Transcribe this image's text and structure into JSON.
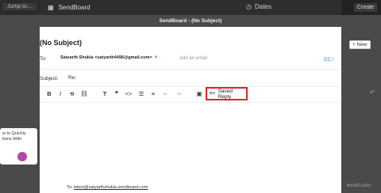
{
  "topbar": {
    "jump_placeholder": "Jump to...",
    "brand": "SendBoard",
    "dates": "Dates",
    "create": "Create"
  },
  "compose": {
    "title": "SendBoard - (No Subject)",
    "heading": "(No Subject)",
    "to_label": "To:",
    "to_recipient": "Satyarth Shukla <satyarth4496@gmail.com>",
    "to_placeholder": "Add an email",
    "subject_label": "Subject:",
    "subject_value": "Re:",
    "cc_bcc": "CC /",
    "new_button": "+ New",
    "saved_reply": "Saved Reply",
    "footer_to_label": "To:",
    "footer_to_email": "inbox@satyarthshukla.sendboard.com"
  },
  "sidebar": {
    "card_text": "w to Quickly\ntions With"
  },
  "watermark": "wsxdn.com"
}
